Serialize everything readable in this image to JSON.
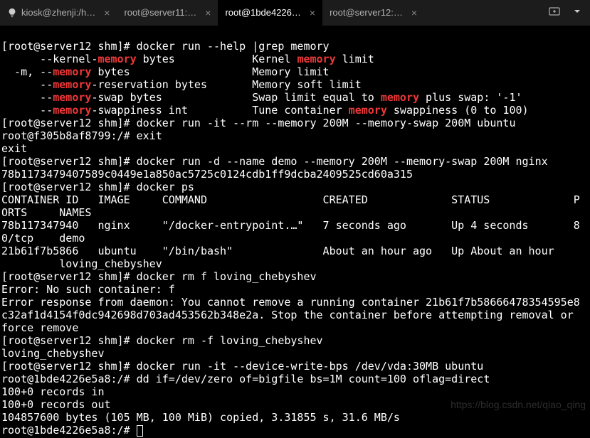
{
  "tabs": [
    {
      "icon": "lightbulb",
      "label": "kiosk@zhenji:/h…"
    },
    {
      "icon": "",
      "label": "root@server11:…"
    },
    {
      "icon": "",
      "label": "root@1bde4226…"
    },
    {
      "icon": "",
      "label": "root@server12:…"
    }
  ],
  "prompt_srv12": "[root@server12 shm]# ",
  "prompt_container1": "root@f305b8af8799:/# ",
  "prompt_container2": "root@1bde4226e5a8:/# ",
  "cmd1": "docker run --help |grep memory",
  "opt1_pre": "      --kernel-",
  "opt1_post": " bytes            Kernel ",
  "opt1_end": " limit",
  "opt2_pre": "  -m, --",
  "opt2_post": " bytes                   Memory limit",
  "opt3_pre": "      --",
  "opt3_post": "-reservation bytes       Memory soft limit",
  "opt4_pre": "      --",
  "opt4_post": "-swap bytes              Swap limit equal to ",
  "opt4_end": " plus swap: '-1'",
  "opt5_pre": "      --",
  "opt5_post": "-swappiness int          Tune container ",
  "opt5_end": " swappiness (0 to 100)",
  "kw_memory": "memory",
  "cmd2": "docker run -it --rm --memory 200M --memory-swap 200M ubuntu",
  "exit_cmd": "exit",
  "exit_out": "exit",
  "cmd3": "docker run -d --name demo --memory 200M --memory-swap 200M nginx",
  "cid_full": "78b1173479407589c0449e1a850ac5725c0124cdb1ff9dcba2409525cd60a315",
  "cmd4": "docker ps",
  "ps_header": "CONTAINER ID   IMAGE     COMMAND                  CREATED             STATUS             P\nORTS     NAMES",
  "ps_row1": "78b117347940   nginx     \"/docker-entrypoint.…\"   7 seconds ago       Up 4 seconds       8\n0/tcp    demo",
  "ps_row2": "21b61f7b5866   ubuntu    \"/bin/bash\"              About an hour ago   Up About an hour    \n         loving_chebyshev",
  "cmd5": "docker rm f loving_chebyshev",
  "err1": "Error: No such container: f",
  "err2": "Error response from daemon: You cannot remove a running container 21b61f7b58666478354595e8\nc32af1d4154f0dc942698d703ad453562b348e2a. Stop the container before attempting removal or \nforce remove",
  "cmd6": "docker rm -f loving_chebyshev",
  "out6": "loving_chebyshev",
  "cmd7": "docker run -it --device-write-bps /dev/vda:30MB ubuntu",
  "cmd8": "dd if=/dev/zero of=bigfile bs=1M count=100 oflag=direct",
  "dd_out1": "100+0 records in",
  "dd_out2": "100+0 records out",
  "dd_out3": "104857600 bytes (105 MB, 100 MiB) copied, 3.31855 s, 31.6 MB/s",
  "watermark": "https://blog.csdn.net/qiao_qing"
}
